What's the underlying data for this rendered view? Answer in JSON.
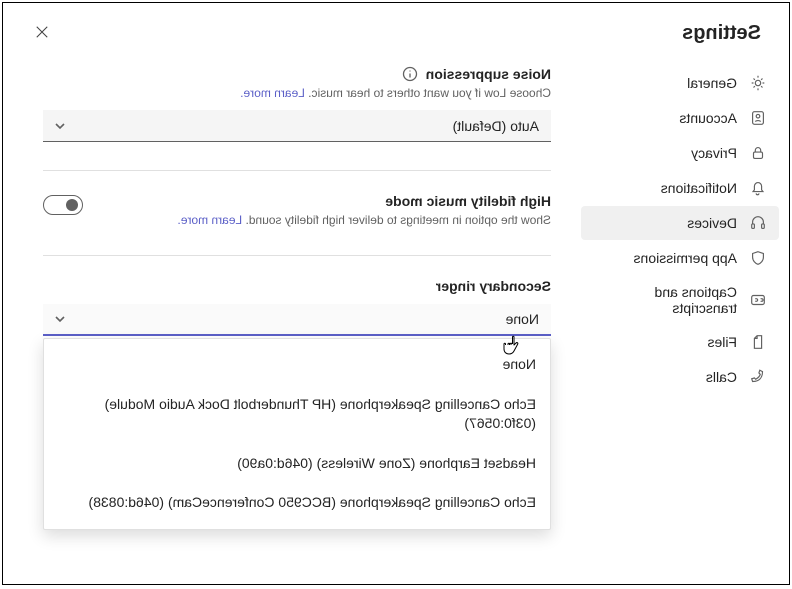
{
  "header": {
    "title": "Settings"
  },
  "nav": {
    "items": [
      {
        "label": "General"
      },
      {
        "label": "Accounts"
      },
      {
        "label": "Privacy"
      },
      {
        "label": "Notifications"
      },
      {
        "label": "Devices"
      },
      {
        "label": "App permissions"
      },
      {
        "label": "Captions and transcripts"
      },
      {
        "label": "Files"
      },
      {
        "label": "Calls"
      }
    ]
  },
  "noise": {
    "title": "Noise suppression",
    "helper": "Choose Low if you want others to hear music. ",
    "learn_more": "Learn more.",
    "value": "Auto (Default)"
  },
  "hifi": {
    "title": "High fidelity music mode",
    "helper": "Show the option in meetings to deliver high fidelity sound. ",
    "learn_more": "Learn more."
  },
  "ringer": {
    "title": "Secondary ringer",
    "value": "None",
    "options": [
      "None",
      "Echo Cancelling Speakerphone (HP Thunderbolt Dock Audio Module) (03f0:0567)",
      "Headset Earphone (Zone Wireless) (046d:0a90)",
      "Echo Cancelling Speakerphone (BCC950 ConferenceCam) (046d:0838)"
    ]
  }
}
